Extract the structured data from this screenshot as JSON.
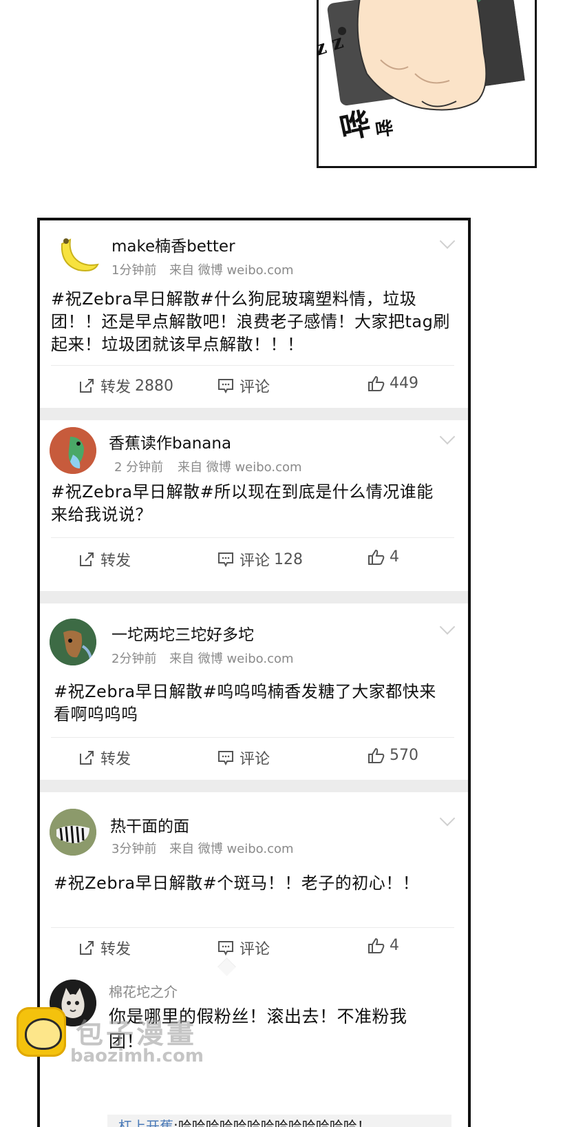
{
  "manga": {
    "sfx_large": "哗",
    "sfx_small": "哗",
    "sfx_side": "z z"
  },
  "posts": [
    {
      "username": "make楠香better",
      "time": "1分钟前",
      "source": "来自 微博 weibo.com",
      "text": "#祝Zebra早日解散#什么狗屁玻璃塑料情，垃圾团！！还是早点解散吧！浪费老子感情！大家把tag刷起来！垃圾团就该早点解散！！！",
      "repost_label": "转发",
      "repost_count": "2880",
      "comment_label": "评论",
      "comment_count": "",
      "like_count": "449",
      "avatar": "banana-avatar"
    },
    {
      "username": "香蕉读作banana",
      "time": "2 分钟前",
      "source": "来自 微博 weibo.com",
      "text": "#祝Zebra早日解散#所以现在到底是什么情况谁能来给我说说？",
      "repost_label": "转发",
      "repost_count": "",
      "comment_label": "评论",
      "comment_count": "128",
      "like_count": "4",
      "avatar": "bird-avatar"
    },
    {
      "username": "一坨两坨三坨好多坨",
      "time": "2分钟前",
      "source": "来自 微博 weibo.com",
      "text": "#祝Zebra早日解散#呜呜呜楠香发糖了大家都快来看啊呜呜呜",
      "repost_label": "转发",
      "repost_count": "",
      "comment_label": "评论",
      "comment_count": "",
      "like_count": "570",
      "avatar": "deer-avatar"
    },
    {
      "username": "热干面的面",
      "time": "3分钟前",
      "source": "来自 微博 weibo.com",
      "text": "#祝Zebra早日解散#个斑马！！老子的初心！！",
      "repost_label": "转发",
      "repost_count": "",
      "comment_label": "评论",
      "comment_count": "",
      "like_count": "4",
      "avatar": "zebra-avatar"
    }
  ],
  "comment": {
    "username": "棉花坨之介",
    "text": "你是哪里的假粉丝！滚出去！不准粉我团！",
    "reply_name": "杠上开蕉",
    "reply_text": "哈哈哈哈哈哈哈哈哈哈哈哈哈！"
  },
  "watermark": {
    "brand": "包子漫畫",
    "url": "baozimh.com"
  },
  "colors": {
    "divider": "#ececec",
    "meta": "#8a8a8a",
    "link": "#4a7ab8",
    "watermark_logo": "#f4c20d"
  }
}
